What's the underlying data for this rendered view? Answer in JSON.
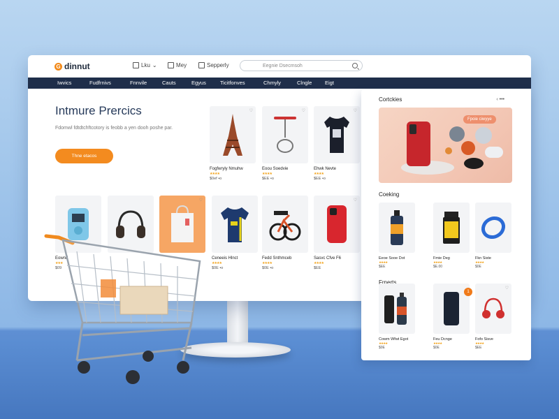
{
  "header": {
    "logo_text": "dinnut",
    "items": [
      "Lku",
      "Mey",
      "Sepperly"
    ],
    "search_placeholder": "Eegnie Dsecmsoh"
  },
  "nav": [
    "Iwvics",
    "Fudfrnivs",
    "Fnnvile",
    "Cauts",
    "Egyus",
    "Ticitfonves",
    "Chmyly",
    "Clngle",
    "Eigt"
  ],
  "hero": {
    "title": "Intmure Prercics",
    "subtitle": "Fdomwl fdtdtchftcotory is feobb a yen dooh poshe par.",
    "button": "Thne etacos"
  },
  "products_top": [
    {
      "name": "Fogfwryly Nmuhw",
      "stars": "★★★★",
      "price": "$0ef •o"
    },
    {
      "name": "Eoou Soedvie",
      "stars": "★★★★",
      "price": "$EE •o"
    },
    {
      "name": "Ehwk Nevte",
      "stars": "★★★★",
      "price": "$EE •o"
    }
  ],
  "products_bottom": [
    {
      "name": "Eownd",
      "stars": "★★★",
      "price": "$09"
    },
    {
      "name": "",
      "stars": "",
      "price": ""
    },
    {
      "name": "",
      "stars": "",
      "price": ""
    },
    {
      "name": "Ceneeis Hlnct",
      "stars": "★★★★",
      "price": "$0E •o"
    },
    {
      "name": "Fedd Snthmceb",
      "stars": "★★★★",
      "price": "$0E •o"
    },
    {
      "name": "Sasvc Cfve F6",
      "stars": "★★★★",
      "price": "$EE"
    }
  ],
  "panel": {
    "section1": "Cortckies",
    "arrows": "‹ •••",
    "banner_tag": "Fpoie ciwyye",
    "section2": "Coeking",
    "section3": "Frnerts",
    "row1": [
      {
        "name": "Eeoe Sooe Dot",
        "stars": "★★★★",
        "price": "$EE"
      },
      {
        "name": "Fmie Deg",
        "stars": "★★★★",
        "price": "$E.00"
      },
      {
        "name": "Fkn Siste",
        "stars": "★★★★",
        "price": "$0E"
      }
    ],
    "row2": [
      {
        "name": "Cowm Wfwt Egot",
        "stars": "★★★★",
        "price": "$0E"
      },
      {
        "name": "Feu Dcnge",
        "stars": "★★★★",
        "price": "$0E"
      },
      {
        "name": "Fofo Sisve",
        "stars": "★★★★",
        "price": "$EE"
      }
    ]
  },
  "colors": {
    "accent": "#f38b1f",
    "nav_bg": "#1f2e4a"
  }
}
